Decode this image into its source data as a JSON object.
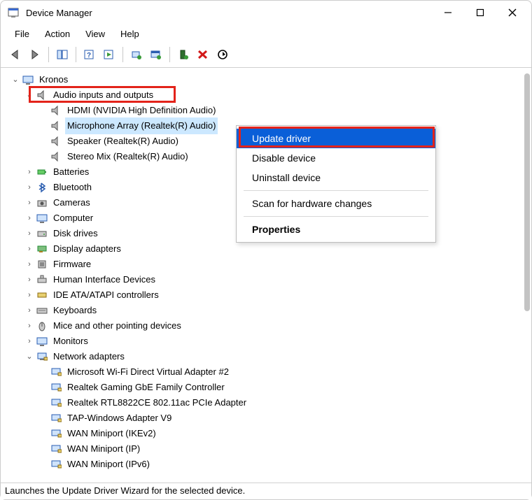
{
  "window": {
    "title": "Device Manager"
  },
  "menu": {
    "file": "File",
    "action": "Action",
    "view": "View",
    "help": "Help"
  },
  "tree": {
    "root": "Kronos",
    "audio_category": "Audio inputs and outputs",
    "audio_items": {
      "hdmi": "HDMI (NVIDIA High Definition Audio)",
      "mic": "Microphone Array (Realtek(R) Audio)",
      "speaker": "Speaker (Realtek(R) Audio)",
      "stereo": "Stereo Mix (Realtek(R) Audio)"
    },
    "categories": {
      "batteries": "Batteries",
      "bluetooth": "Bluetooth",
      "cameras": "Cameras",
      "computer": "Computer",
      "disk": "Disk drives",
      "display": "Display adapters",
      "firmware": "Firmware",
      "hid": "Human Interface Devices",
      "ide": "IDE ATA/ATAPI controllers",
      "keyboards": "Keyboards",
      "mice": "Mice and other pointing devices",
      "monitors": "Monitors",
      "network": "Network adapters"
    },
    "network_items": {
      "n0": "Microsoft Wi-Fi Direct Virtual Adapter #2",
      "n1": "Realtek Gaming GbE Family Controller",
      "n2": "Realtek RTL8822CE 802.11ac PCIe Adapter",
      "n3": "TAP-Windows Adapter V9",
      "n4": "WAN Miniport (IKEv2)",
      "n5": "WAN Miniport (IP)",
      "n6": "WAN Miniport (IPv6)"
    }
  },
  "context_menu": {
    "update": "Update driver",
    "disable": "Disable device",
    "uninstall": "Uninstall device",
    "scan": "Scan for hardware changes",
    "properties": "Properties"
  },
  "status": "Launches the Update Driver Wizard for the selected device."
}
